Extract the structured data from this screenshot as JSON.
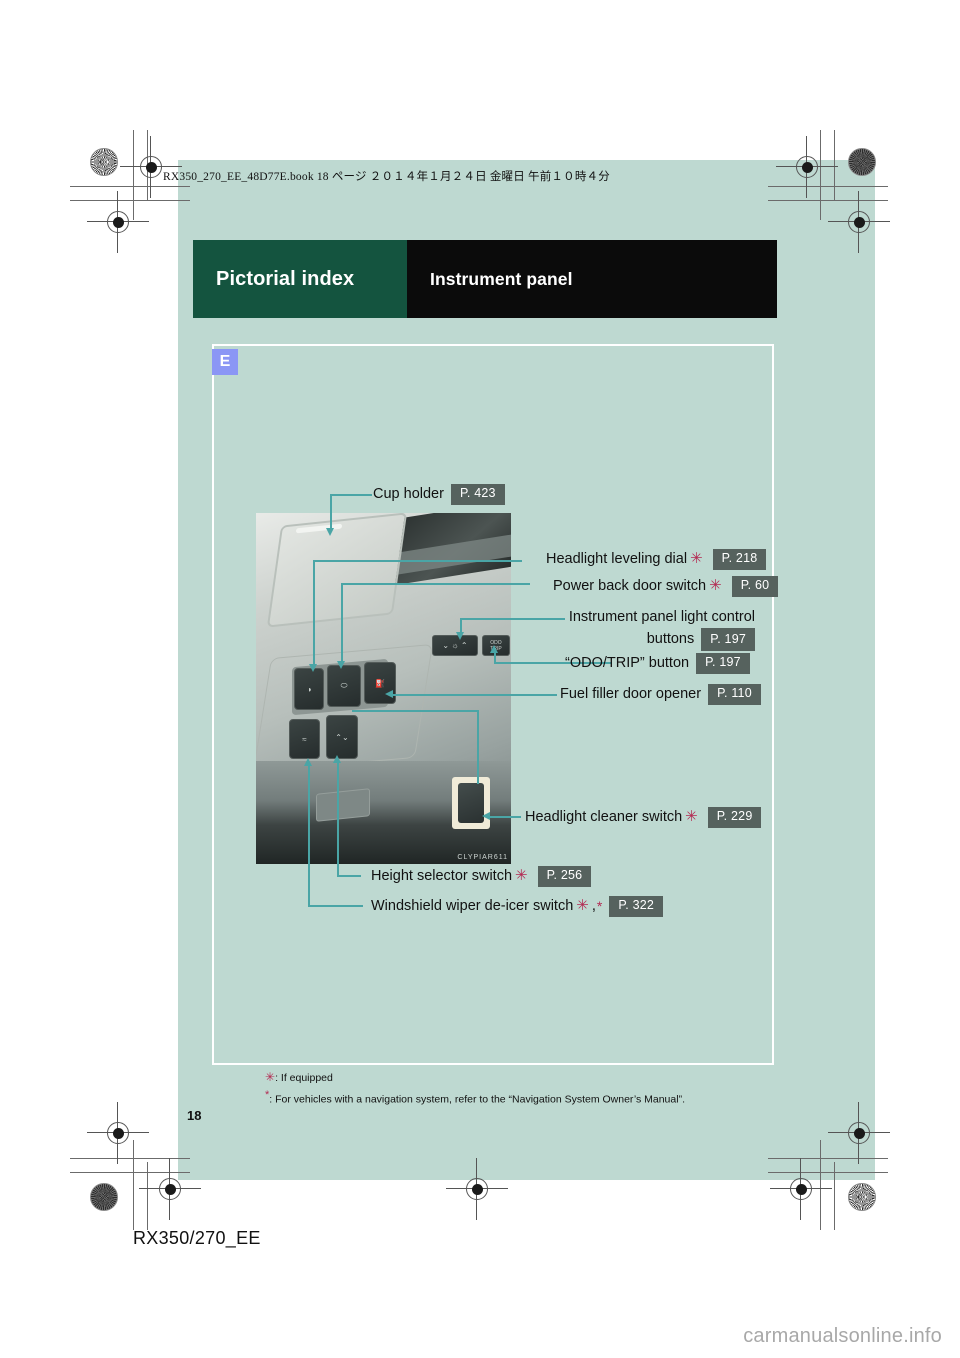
{
  "document": {
    "book_line": "RX350_270_EE_48D77E.book   18 ページ   ２０１４年１月２４日   金曜日   午前１０時４分",
    "page_number": "18",
    "model_footer": "RX350/270_EE",
    "watermark": "carmanualsonline.info"
  },
  "titlebar": {
    "section": "Pictorial index",
    "subject": "Instrument panel"
  },
  "content": {
    "badge": "E",
    "photo_code": "CLYPIAR611"
  },
  "callouts": [
    {
      "id": "cup-holder",
      "text": "Cup holder",
      "page": "P. 423",
      "if_equipped": false,
      "nav_note": false
    },
    {
      "id": "headlight-leveling-dial",
      "text": "Headlight leveling dial",
      "page": "P. 218",
      "if_equipped": true,
      "nav_note": false
    },
    {
      "id": "power-back-door-switch",
      "text": "Power back door switch",
      "page": "P. 60",
      "if_equipped": true,
      "nav_note": false
    },
    {
      "id": "instrument-panel-light",
      "text": "Instrument panel light control",
      "text2": "buttons",
      "page": "P. 197",
      "if_equipped": false,
      "nav_note": false
    },
    {
      "id": "odo-trip-button",
      "text": "“ODO/TRIP” button",
      "page": "P. 197",
      "if_equipped": false,
      "nav_note": false
    },
    {
      "id": "fuel-filler-door-opener",
      "text": "Fuel filler door opener",
      "page": "P. 110",
      "if_equipped": false,
      "nav_note": false
    },
    {
      "id": "headlight-cleaner-switch",
      "text": "Headlight cleaner switch",
      "page": "P. 229",
      "if_equipped": true,
      "nav_note": false
    },
    {
      "id": "height-selector-switch",
      "text": "Height selector switch",
      "page": "P. 256",
      "if_equipped": true,
      "nav_note": false
    },
    {
      "id": "windshield-wiper-deicer",
      "text": "Windshield wiper de-icer switch",
      "page": "P. 322",
      "if_equipped": true,
      "nav_note": true
    }
  ],
  "footnotes": {
    "if_equipped": ": If equipped",
    "nav_note": ": For vehicles with a navigation system, refer to the “Navigation System Owner’s Manual”."
  },
  "colors": {
    "sheet_bg": "#bed9d1",
    "section_green": "#14543f",
    "subject_black": "#0b0b0b",
    "badge_blue": "#8b96f5",
    "page_ref_bg": "#56625e",
    "callout_line": "#4aa5a6",
    "asterisk_red": "#b32a52"
  }
}
